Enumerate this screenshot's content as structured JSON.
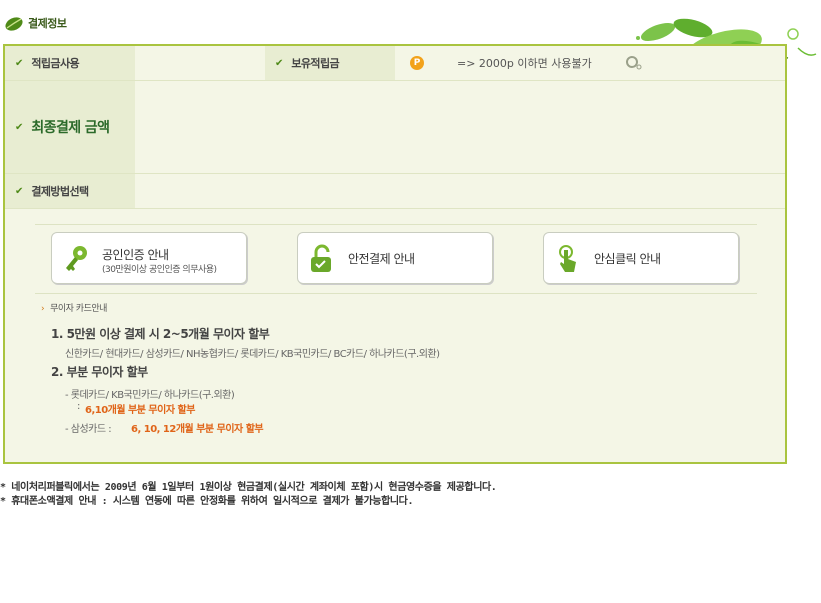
{
  "header": {
    "title": "결제정보",
    "icon": "leaf-icon"
  },
  "rows": {
    "points_use_label": "적립금사용",
    "points_held_label": "보유적립금",
    "points_badge": "P",
    "points_note": "=> 2000p 이하면 사용불가",
    "final_amount_label": "최종결제 금액",
    "payment_method_label": "결제방법선택"
  },
  "buttons": [
    {
      "title": "공인인증 안내",
      "sub": "(30만원이상 공인인증 의무사용)",
      "icon": "key-icon"
    },
    {
      "title": "안전결제 안내",
      "sub": "",
      "icon": "lock-icon"
    },
    {
      "title": "안심클릭 안내",
      "sub": "",
      "icon": "click-icon"
    }
  ],
  "installment": {
    "heading": "무이자 카드안내",
    "item1": "1. 5만원 이상 결제 시 2~5개월 무이자 할부",
    "item1_cards": "신한카드/ 현대카드/ 삼성카드/ NH농협카드/ 롯데카드/ KB국민카드/ BC카드/ 하나카드(구.외환)",
    "item2": "2. 부분 무이자 할부",
    "item2_cards_a": "- 롯데카드/ KB국민카드/ 하나카드(구.외환)",
    "item2_colon_a": ":",
    "item2_terms_a": "6,10개월 부분 무이자 할부",
    "item2_cards_b": "- 삼성카드 :",
    "item2_terms_b": "6, 10, 12개월 부분 무이자 할부"
  },
  "footer": {
    "line1": "* 네이처리퍼블릭에서는 2009년 6월 1일부터 1원이상 현금결제(실시간 계좌이체 포함)시 현금영수증을 제공합니다.",
    "line2": "* 휴대폰소액결제 안내 : 시스템 연동에 따른 안정화를 위하여 일시적으로 결제가 불가능합니다."
  },
  "colors": {
    "accent": "#a9c43f",
    "panel_bg": "#f4f6e6",
    "orange": "#e06418",
    "green_text": "#2b6a2a"
  }
}
